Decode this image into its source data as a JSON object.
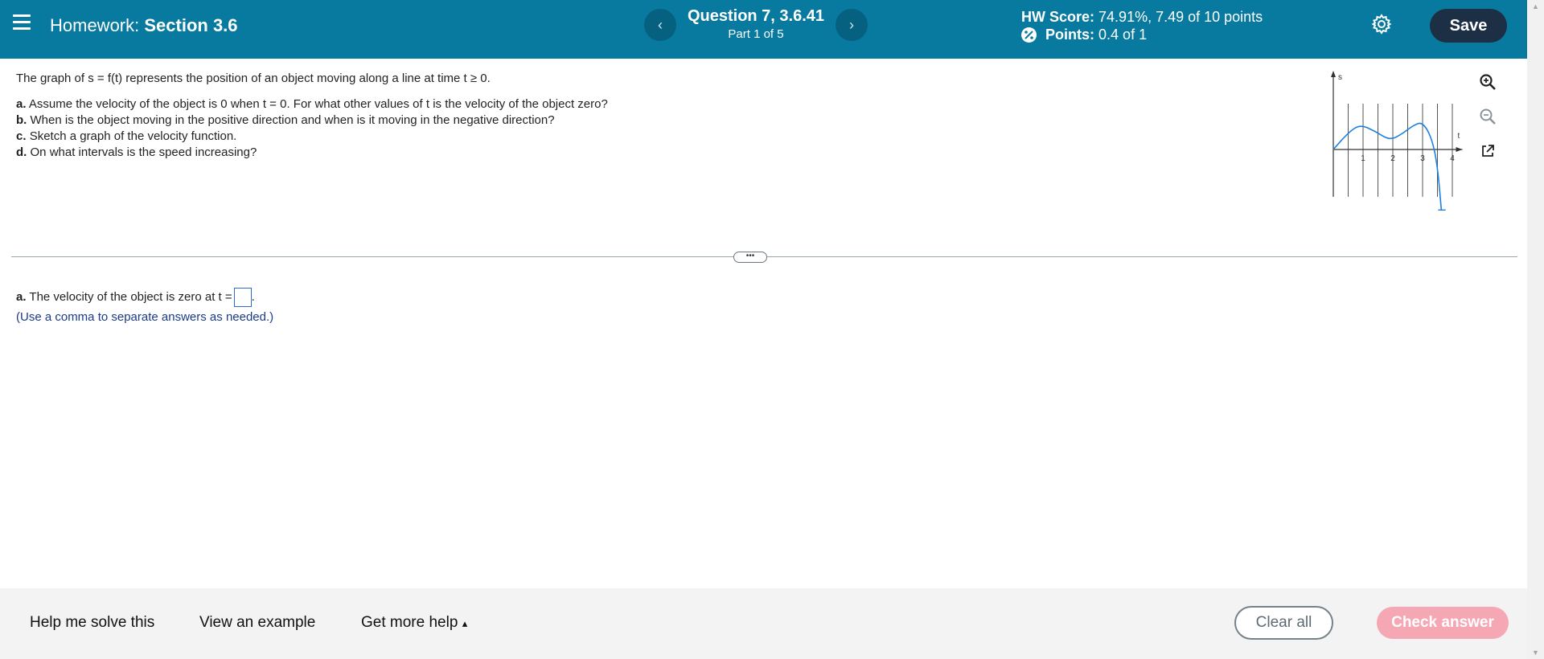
{
  "header": {
    "hw_label": "Homework:",
    "hw_name": "Section 3.6",
    "prev_glyph": "‹",
    "next_glyph": "›",
    "question_title": "Question 7, 3.6.41",
    "question_part": "Part 1 of 5",
    "score_label": "HW Score:",
    "score_value": "74.91%, 7.49 of 10 points",
    "points_label": "Points:",
    "points_value": "0.4 of 1",
    "save_label": "Save"
  },
  "problem": {
    "intro": "The graph of s = f(t) represents the position of an object moving along a line at time t ≥ 0.",
    "items": [
      {
        "letter": "a.",
        "text": "Assume the velocity of the object is 0 when t = 0. For what other values of t is the velocity of the object zero?"
      },
      {
        "letter": "b.",
        "text": "When is the object moving in the positive direction and when is it moving in the negative direction?"
      },
      {
        "letter": "c.",
        "text": "Sketch a graph of the velocity function."
      },
      {
        "letter": "d.",
        "text": "On what intervals is the speed increasing?"
      }
    ]
  },
  "chart_data": {
    "type": "line",
    "title": "",
    "xlabel": "t",
    "ylabel": "s",
    "x_ticks": [
      "1",
      "2",
      "3",
      "4"
    ],
    "xlim": [
      0,
      4.5
    ],
    "grid": true,
    "series": [
      {
        "values": [
          [
            0,
            0
          ],
          [
            0.5,
            0.55
          ],
          [
            0.9,
            0.82
          ],
          [
            1.4,
            0.6
          ],
          [
            1.9,
            0.3
          ],
          [
            2.3,
            0.5
          ],
          [
            2.7,
            0.8
          ],
          [
            3.0,
            0.9
          ],
          [
            3.3,
            0.4
          ],
          [
            3.5,
            -0.5
          ],
          [
            3.65,
            -2.2
          ]
        ]
      }
    ],
    "colors": {
      "curve": "#1e7fe0",
      "axis": "#333333",
      "grid": "#555555"
    }
  },
  "divider": {
    "handle_glyph": "•••"
  },
  "answer": {
    "prefix_letter": "a.",
    "prefix_text": "The velocity of the object is zero at t =",
    "suffix": ".",
    "hint": "(Use a comma to separate answers as needed.)"
  },
  "footer": {
    "help_solve": "Help me solve this",
    "view_example": "View an example",
    "more_help": "Get more help",
    "more_help_arrow": "▴",
    "clear_all": "Clear all",
    "check_answer": "Check answer"
  },
  "colors": {
    "header_bg": "#08799f",
    "save_bg": "#1c2f45",
    "check_bg": "#f5a8b3"
  },
  "icons": {
    "menu": "hamburger-icon",
    "settings": "gear-icon",
    "zoom_in": "zoom-in-icon",
    "zoom_out": "zoom-out-icon",
    "popout": "external-link-icon",
    "points": "partial-credit-icon"
  }
}
